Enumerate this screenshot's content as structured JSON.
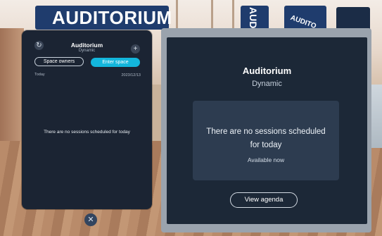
{
  "environment": {
    "banner_left": "AUDITORIUM",
    "banner_right": "AUDI",
    "banner_right2": "AUDITO"
  },
  "panel": {
    "title": "Auditorium",
    "subtitle": "Dynamic",
    "refresh_icon": "↻",
    "add_icon": "+",
    "buttons": {
      "space_owners": "Space owners",
      "enter_space": "Enter space"
    },
    "day_label": "Today",
    "date": "2023/12/13",
    "empty_message": "There are no sessions scheduled for today"
  },
  "close_icon": "✕",
  "screen": {
    "title": "Auditorium",
    "subtitle": "Dynamic",
    "message": "There are no sessions scheduled for today",
    "availability": "Available now",
    "agenda_button": "View agenda"
  },
  "colors": {
    "panel_bg": "#1b2433",
    "accent": "#13b6dc",
    "screen_bg": "#1c2837",
    "message_box": "#2d3c50"
  }
}
